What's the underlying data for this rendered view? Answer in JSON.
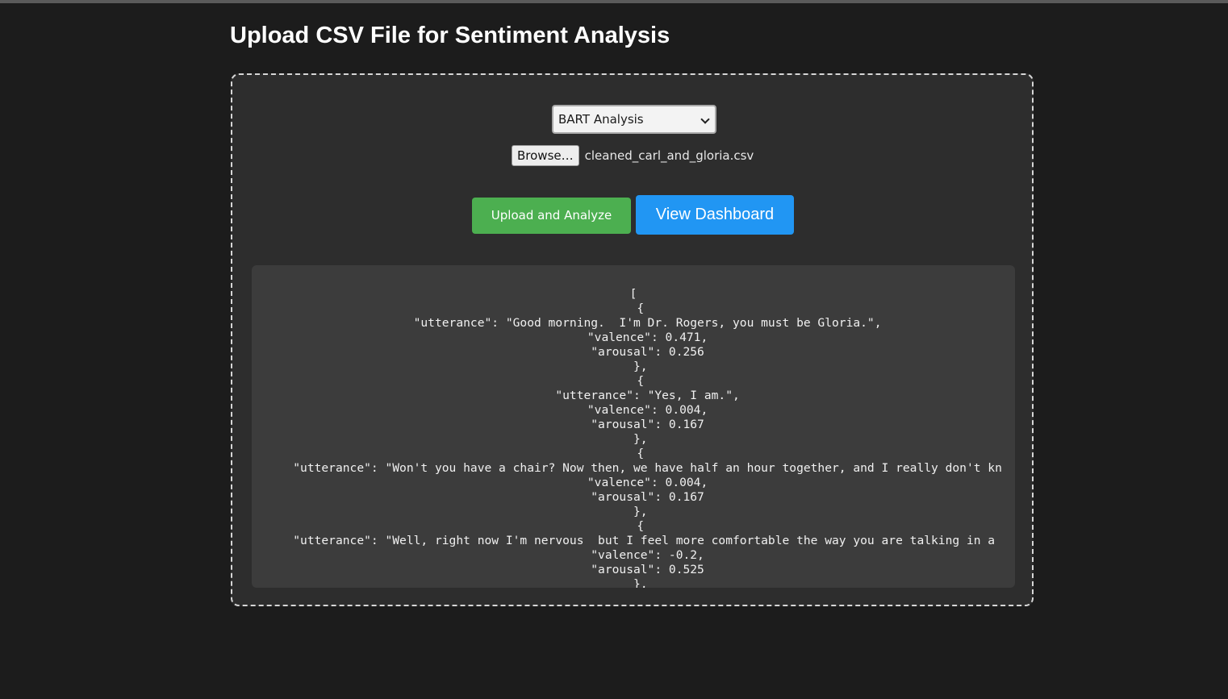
{
  "page": {
    "title": "Upload CSV File for Sentiment Analysis"
  },
  "form": {
    "model_select": {
      "selected": "BART Analysis"
    },
    "file_input": {
      "browse_label": "Browse…",
      "file_name": "cleaned_carl_and_gloria.csv"
    },
    "upload_button_label": "Upload and Analyze",
    "dashboard_button_label": "View Dashboard"
  },
  "colors": {
    "upload_button": "#4caf50",
    "dashboard_button": "#2196f3"
  },
  "icons": {
    "select_arrow": "chevron-down-icon"
  },
  "results": {
    "text": "[\n  {\n    \"utterance\": \"Good morning.  I'm Dr. Rogers, you must be Gloria.\",\n    \"valence\": 0.471,\n    \"arousal\": 0.256\n  },\n  {\n    \"utterance\": \"Yes, I am.\",\n    \"valence\": 0.004,\n    \"arousal\": 0.167\n  },\n  {\n    \"utterance\": \"Won't you have a chair? Now then, we have half an hour together, and I really don't kn\n    \"valence\": 0.004,\n    \"arousal\": 0.167\n  },\n  {\n    \"utterance\": \"Well, right now I'm nervous  but I feel more comfortable the way you are talking in a \n    \"valence\": -0.2,\n    \"arousal\": 0.525\n  },"
  }
}
